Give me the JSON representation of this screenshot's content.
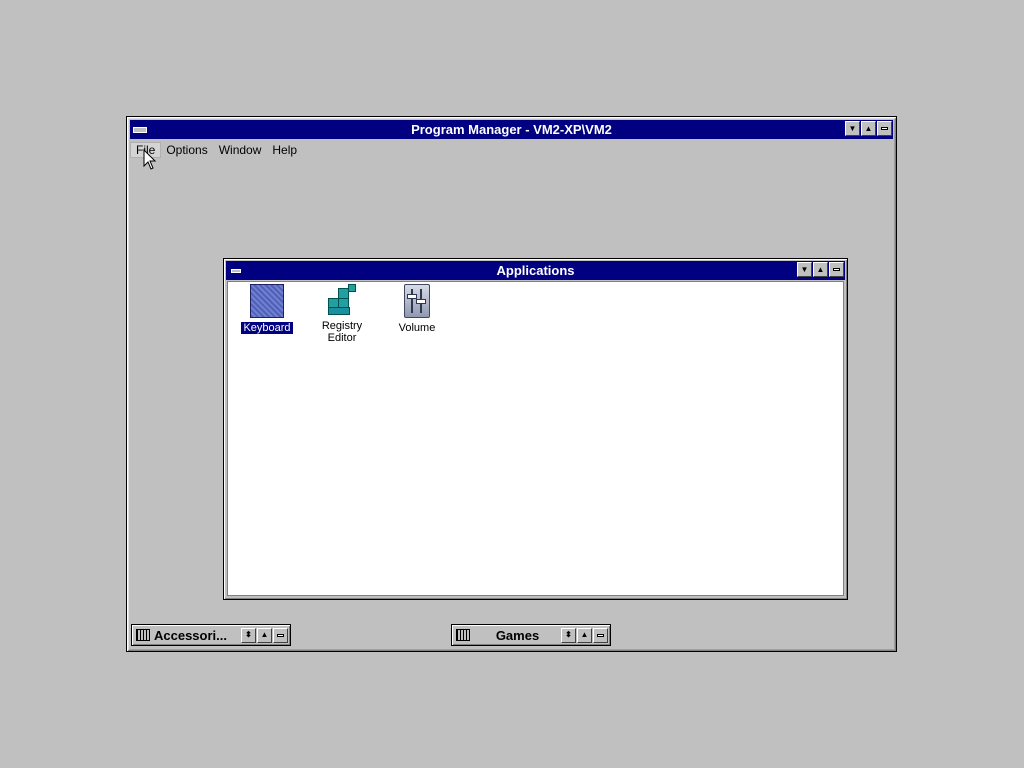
{
  "program_manager": {
    "title": "Program Manager - VM2-XP\\VM2",
    "menu": [
      "File",
      "Options",
      "Window",
      "Help"
    ]
  },
  "applications_window": {
    "title": "Applications",
    "icons": [
      {
        "label": "Keyboard",
        "selected": true,
        "icon": "keyboard-icon"
      },
      {
        "label": "Registry\nEditor",
        "selected": false,
        "icon": "registry-editor-icon"
      },
      {
        "label": "Volume",
        "selected": false,
        "icon": "volume-icon"
      }
    ]
  },
  "minimized_groups": [
    {
      "label": "Accessori..."
    },
    {
      "label": "Games"
    }
  ],
  "colors": {
    "desktop": "#c0c0c0",
    "title_active": "#000080",
    "client": "#ffffff"
  },
  "title_buttons": {
    "minimize": "▼",
    "maximize": "▲",
    "restore": "⬍"
  }
}
